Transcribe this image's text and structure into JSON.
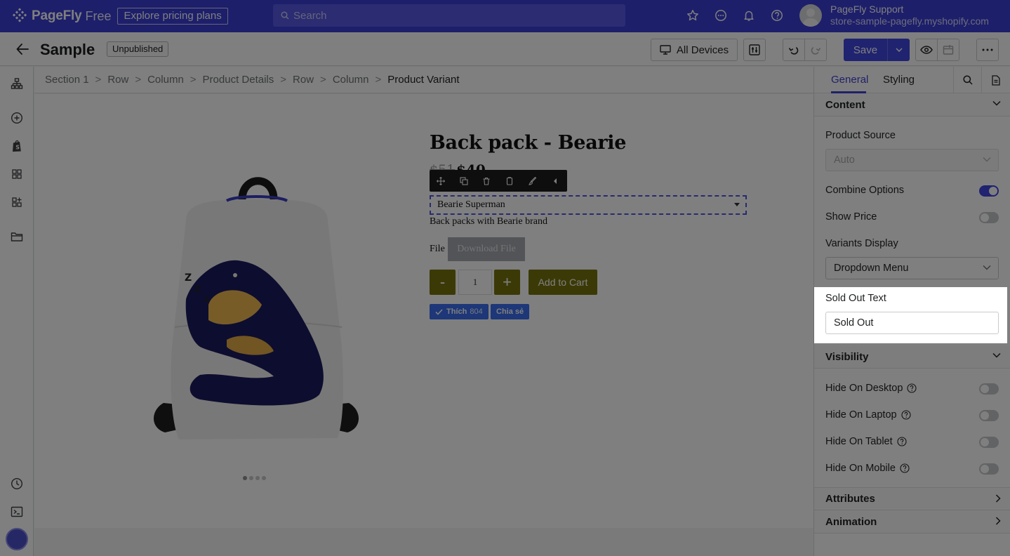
{
  "topbar": {
    "brand": "PageFly",
    "plan": "Free",
    "pricing_label": "Explore pricing plans",
    "search_placeholder": "Search",
    "user_name": "PageFly Support",
    "user_store": "store-sample-pagefly.myshopify.com"
  },
  "subheader": {
    "title": "Sample",
    "status": "Unpublished",
    "devices_label": "All Devices",
    "save_label": "Save"
  },
  "breadcrumb": [
    "Section 1",
    "Row",
    "Column",
    "Product Details",
    "Row",
    "Column",
    "Product Variant"
  ],
  "product": {
    "title": "Back pack - Bearie",
    "price_old": "$51",
    "price_new": "$40",
    "variant": "Bearie Superman",
    "description": "Back packs with Bearie brand",
    "file_label": "File",
    "download_label": "Download File",
    "qty_minus": "-",
    "qty_value": "1",
    "qty_plus": "+",
    "add_to_cart": "Add to Cart",
    "like_label": "Thích",
    "like_count": "804",
    "share_label": "Chia sẻ"
  },
  "panel": {
    "tab_general": "General",
    "tab_styling": "Styling",
    "content_heading": "Content",
    "product_source_label": "Product Source",
    "product_source_value": "Auto",
    "combine_options_label": "Combine Options",
    "combine_options_on": true,
    "show_price_label": "Show Price",
    "show_price_on": false,
    "variants_display_label": "Variants Display",
    "variants_display_value": "Dropdown Menu",
    "sold_out_label": "Sold Out Text",
    "sold_out_value": "Sold Out",
    "visibility_heading": "Visibility",
    "hide_desktop": "Hide On Desktop",
    "hide_laptop": "Hide On Laptop",
    "hide_tablet": "Hide On Tablet",
    "hide_mobile": "Hide On Mobile",
    "attributes_heading": "Attributes",
    "animation_heading": "Animation"
  },
  "colors": {
    "brand": "#3b3fd6",
    "accent": "#4146e0",
    "cart_button": "#77740e",
    "facebook": "#3b6ff0"
  }
}
